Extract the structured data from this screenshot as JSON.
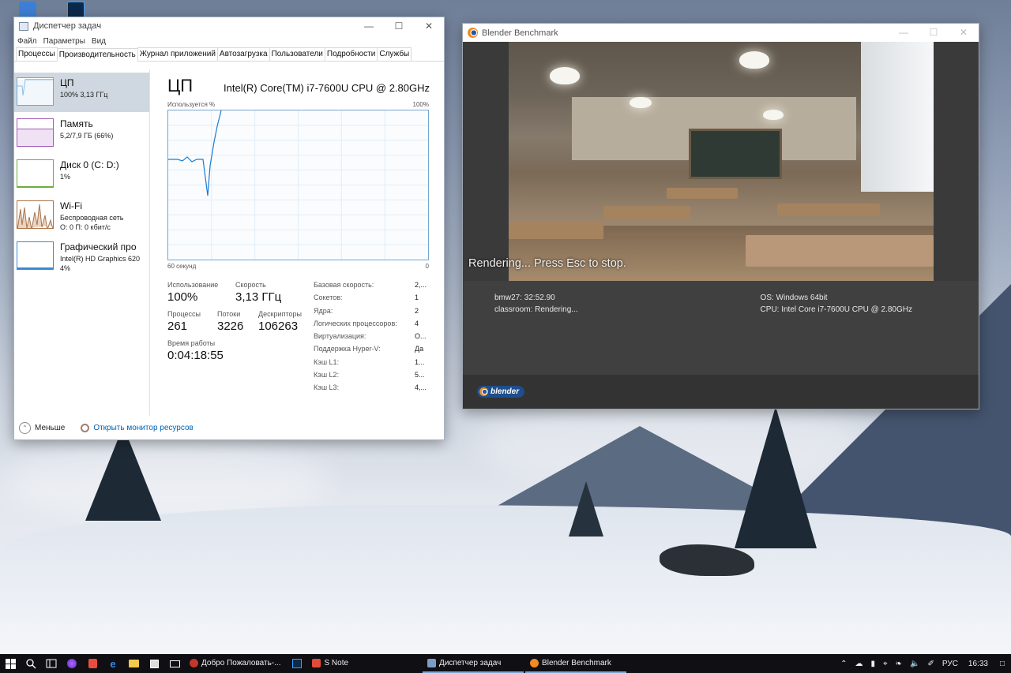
{
  "task_manager": {
    "window_title": "Диспетчер задач",
    "menu": [
      "Файл",
      "Параметры",
      "Вид"
    ],
    "tabs": [
      "Процессы",
      "Производительность",
      "Журнал приложений",
      "Автозагрузка",
      "Пользователи",
      "Подробности",
      "Службы"
    ],
    "active_tab": "Производительность",
    "sidebar": [
      {
        "name": "ЦП",
        "sub": "100% 3,13 ГГц"
      },
      {
        "name": "Память",
        "sub": "5,2/7,9 ГБ (66%)"
      },
      {
        "name": "Диск 0 (C: D:)",
        "sub": "1%"
      },
      {
        "name": "Wi-Fi",
        "sub": "Беспроводная сеть",
        "sub2": "О: 0 П: 0 кбит/с"
      },
      {
        "name": "Графический про",
        "sub": "Intel(R) HD Graphics 620",
        "sub2": "4%"
      }
    ],
    "main": {
      "title": "ЦП",
      "cpu_model": "Intel(R) Core(TM) i7-7600U CPU @ 2.80GHz",
      "graph_label_left": "Используется %",
      "graph_label_right": "100%",
      "graph_time_left": "60 секунд",
      "graph_time_right": "0",
      "usage_label": "Использование",
      "usage_value": "100%",
      "speed_label": "Скорость",
      "speed_value": "3,13 ГГц",
      "processes_label": "Процессы",
      "processes_value": "261",
      "threads_label": "Потоки",
      "threads_value": "3226",
      "handles_label": "Дескрипторы",
      "handles_value": "106263",
      "uptime_label": "Время работы",
      "uptime_value": "0:04:18:55",
      "specs": [
        {
          "k": "Базовая скорость:",
          "v": "2,..."
        },
        {
          "k": "Сокетов:",
          "v": "1"
        },
        {
          "k": "Ядра:",
          "v": "2"
        },
        {
          "k": "Логических процессоров:",
          "v": "4"
        },
        {
          "k": "Виртуализация:",
          "v": "О..."
        },
        {
          "k": "Поддержка Hyper-V:",
          "v": "Да"
        },
        {
          "k": "Кэш L1:",
          "v": "1..."
        },
        {
          "k": "Кэш L2:",
          "v": "5..."
        },
        {
          "k": "Кэш L3:",
          "v": "4,..."
        }
      ]
    },
    "footer_less": "Меньше",
    "footer_link": "Открыть монитор ресурсов"
  },
  "blender": {
    "window_title": "Blender Benchmark",
    "status": "Rendering... Press Esc to stop.",
    "info_left": [
      "bmw27: 32:52.90",
      "classroom: Rendering..."
    ],
    "info_right": [
      "OS: Windows 64bit",
      "CPU: Intel Core i7-7600U CPU @ 2.80GHz"
    ],
    "footer_logo": "blender"
  },
  "taskbar": {
    "apps": [
      {
        "label": "Добро Пожаловать-...",
        "color": "#c0392b"
      },
      {
        "label": "S Note",
        "color": "#e04b3a"
      },
      {
        "label": "Диспетчер задач",
        "color": "#7a9cc6"
      },
      {
        "label": "Blender Benchmark",
        "color": "#f08a24"
      }
    ],
    "lang": "РУС",
    "time": "16:33"
  }
}
